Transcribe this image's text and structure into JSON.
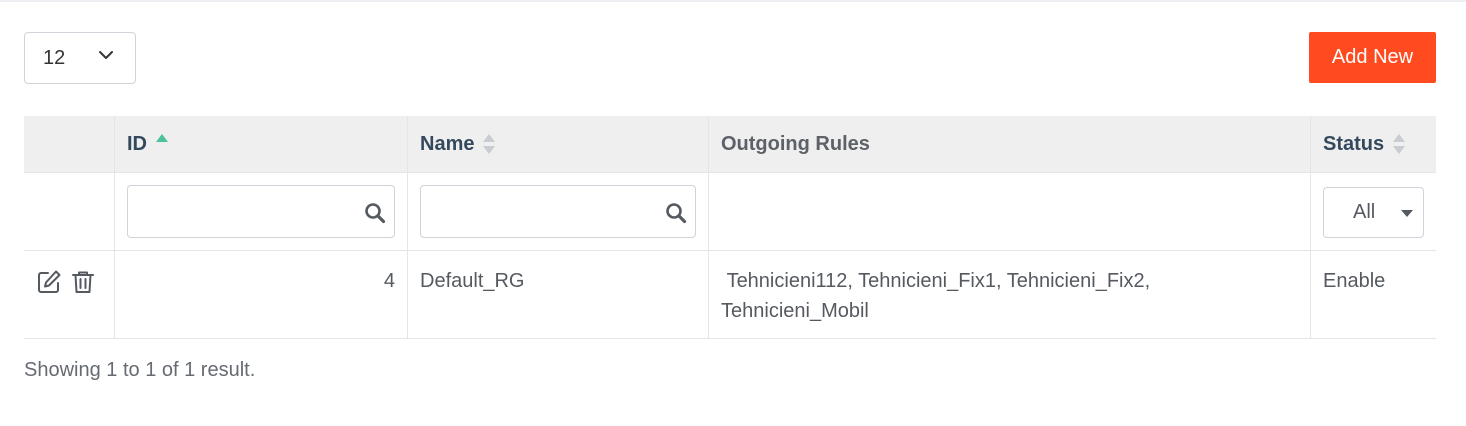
{
  "page_size": {
    "value": "12"
  },
  "toolbar": {
    "add_label": "Add New"
  },
  "table": {
    "columns": [
      {
        "key": "id",
        "label": "ID",
        "sort": "asc"
      },
      {
        "key": "name",
        "label": "Name",
        "sort": "none"
      },
      {
        "key": "outgoing_rules",
        "label": "Outgoing Rules"
      },
      {
        "key": "status",
        "label": "Status",
        "sort": "none"
      }
    ],
    "filters": {
      "id": "",
      "name": "",
      "status": "All"
    },
    "rows": [
      {
        "id": "4",
        "name": "Default_RG",
        "outgoing_rules": " Tehnicieni112, Tehnicieni_Fix1, Tehnicieni_Fix2, Tehnicieni_Mobil",
        "status": "Enable"
      }
    ]
  },
  "footer": {
    "summary": "Showing 1 to 1 of 1 result."
  },
  "colors": {
    "accent": "#ff4b1f",
    "sort_active": "#4cc29a",
    "sort_inactive": "#c8ccd1",
    "header_bg": "#efefef",
    "header_text": "#35495e"
  },
  "icons": {
    "page_size_toggle": "chevron-down-icon",
    "sort_asc": "sort-asc-icon",
    "sort_none": "sort-icon",
    "search": "search-icon",
    "edit": "edit-icon",
    "delete": "trash-icon",
    "status_toggle": "caret-down-icon"
  }
}
